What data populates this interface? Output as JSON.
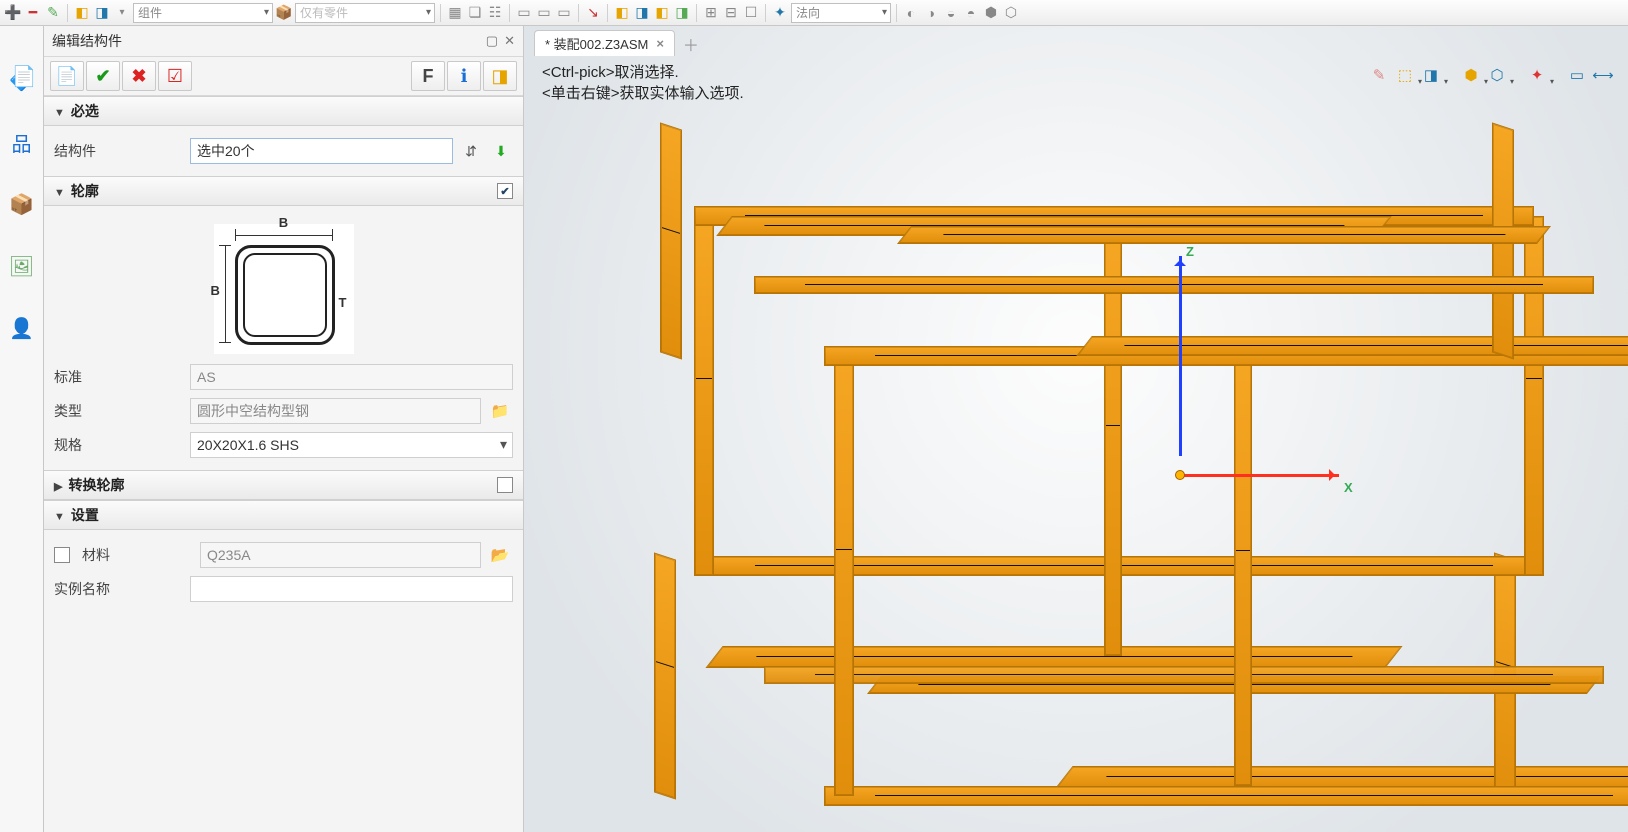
{
  "top": {
    "dropdown1": "组件",
    "dropdown2": "仅有零件",
    "dropdown3": "法向"
  },
  "panel": {
    "title": "编辑结构件",
    "toolbar": {
      "f_label": "F"
    },
    "sec_required": "必选",
    "member_label": "结构件",
    "member_value": "选中20个",
    "sec_profile": "轮廓",
    "dim_B": "B",
    "dim_T": "T",
    "std_label": "标准",
    "std_value": "AS",
    "type_label": "类型",
    "type_value": "圆形中空结构型钢",
    "spec_label": "规格",
    "spec_value": "20X20X1.6 SHS",
    "sec_transform": "转换轮廓",
    "sec_settings": "设置",
    "material_label": "材料",
    "material_value": "Q235A",
    "instance_label": "实例名称",
    "instance_value": ""
  },
  "viewport": {
    "tab_name": "* 装配002.Z3ASM",
    "hint1": "<Ctrl-pick>取消选择.",
    "hint2": "<单击右键>获取实体输入选项.",
    "axis_z": "Z",
    "axis_x": "X"
  }
}
